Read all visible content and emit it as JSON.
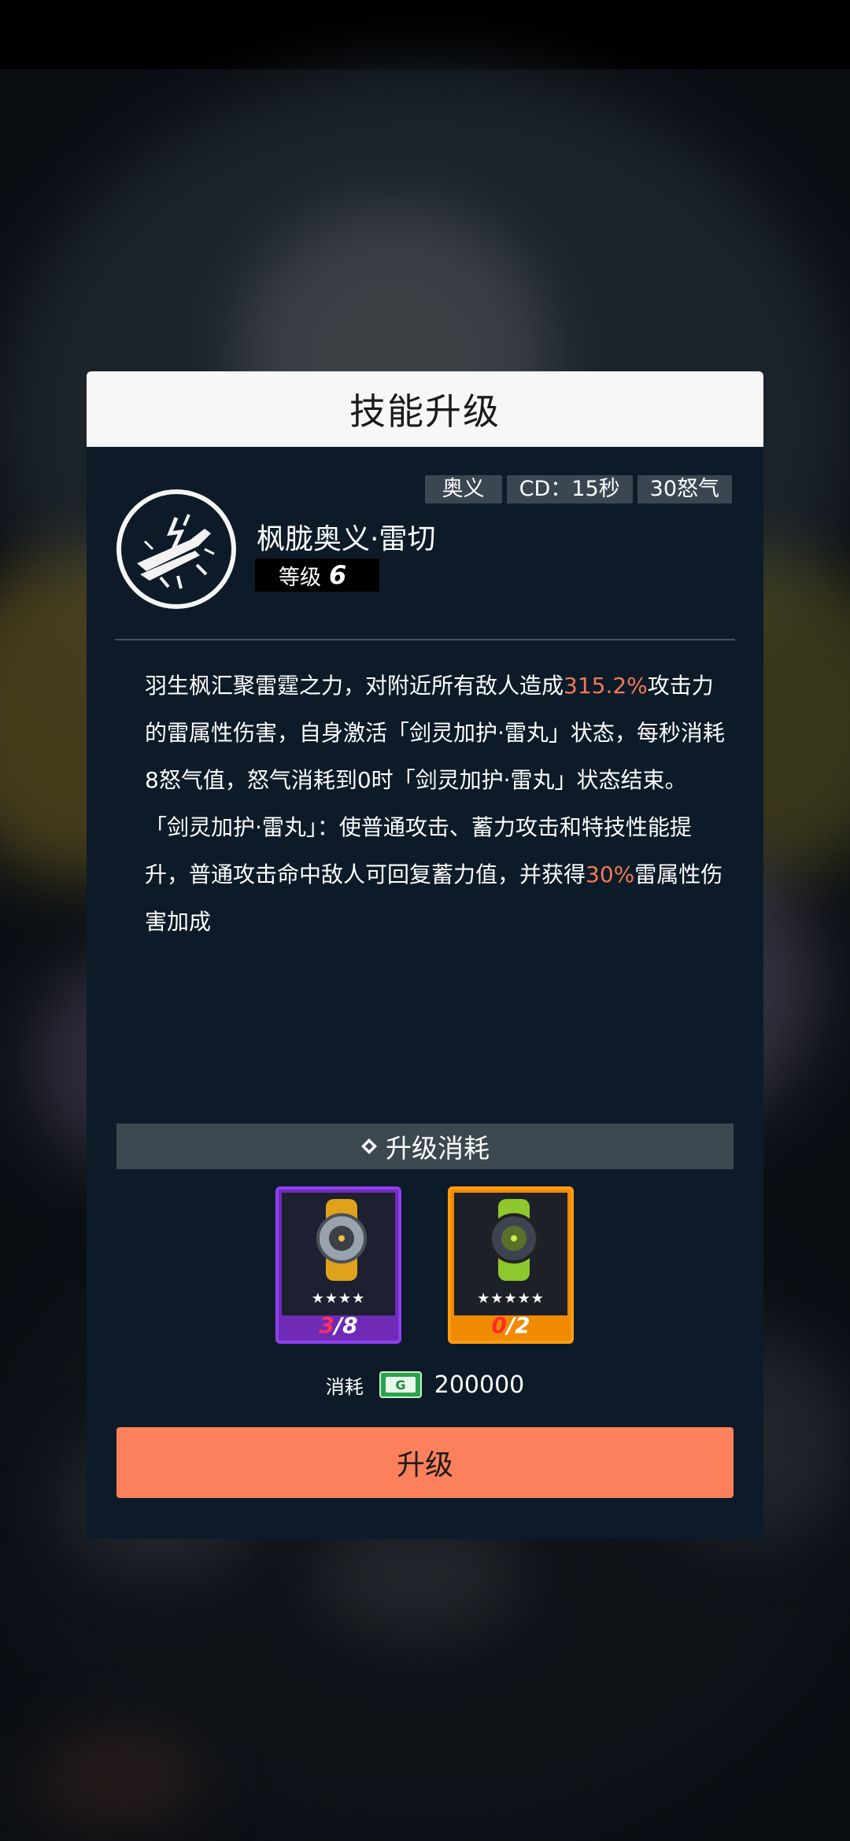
{
  "dialog": {
    "title": "技能升级"
  },
  "skill": {
    "tags": [
      "奥义",
      "CD：15秒",
      "30怒气"
    ],
    "icon": "lightning-slash-icon",
    "name": "枫胧奥义·雷切",
    "level_label": "等级",
    "level_value": "6"
  },
  "description": {
    "p1_a": "羽生枫汇聚雷霆之力，对附近所有敌人造成",
    "p1_hl": "315.2%",
    "p1_b": "攻击力的雷属性伤害，自身激活「剑灵加护·雷丸」状态，每秒消耗8怒气值，怒气消耗到0时「剑灵加护·雷丸」状态结束。",
    "p2_a": "「剑灵加护·雷丸」：使普通攻击、蓄力攻击和特技性能提升，普通攻击命中敌人可回复蓄力值，并获得",
    "p2_hl": "30%",
    "p2_b": "雷属性伤害加成",
    "highlight_color": "#f07a57"
  },
  "cost": {
    "title": "升级消耗",
    "materials": [
      {
        "icon": "yellow-watch-icon",
        "stars": "★★★★",
        "have": "3",
        "need": "/8",
        "frame_color": "#8e3ef0"
      },
      {
        "icon": "green-watch-icon",
        "stars": "★★★★★",
        "have": "0",
        "need": "/2",
        "frame_color": "#ff9d12"
      }
    ],
    "consume_label": "消耗",
    "currency_icon": "gold-coin-icon",
    "consume_value": "200000"
  },
  "actions": {
    "upgrade_label": "升级",
    "upgrade_color": "#fd805c"
  }
}
